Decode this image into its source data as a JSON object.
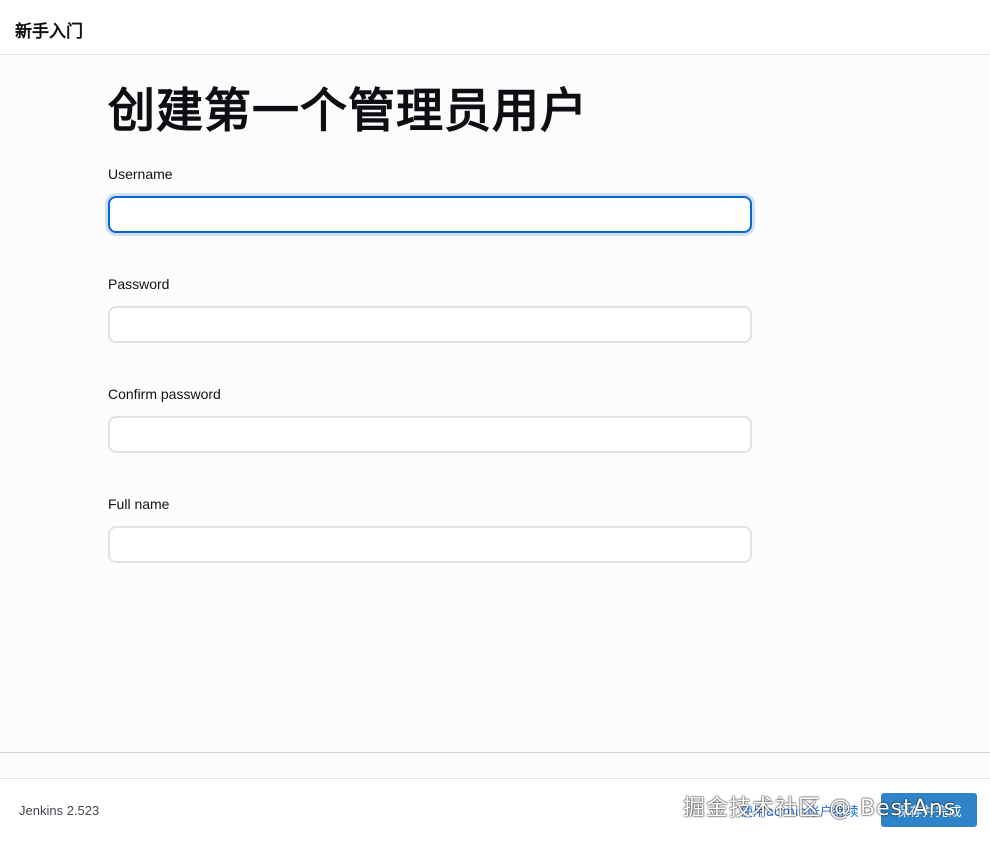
{
  "header": {
    "title": "新手入门"
  },
  "main": {
    "title": "创建第一个管理员用户",
    "fields": [
      {
        "label": "Username",
        "value": ""
      },
      {
        "label": "Password",
        "value": ""
      },
      {
        "label": "Confirm password",
        "value": ""
      },
      {
        "label": "Full name",
        "value": ""
      }
    ]
  },
  "footer": {
    "version": "Jenkins 2.523",
    "skip_label": "使用admin账户继续",
    "save_label": "保存并完成"
  },
  "watermark": "掘金技术社区 @ BestAns"
}
